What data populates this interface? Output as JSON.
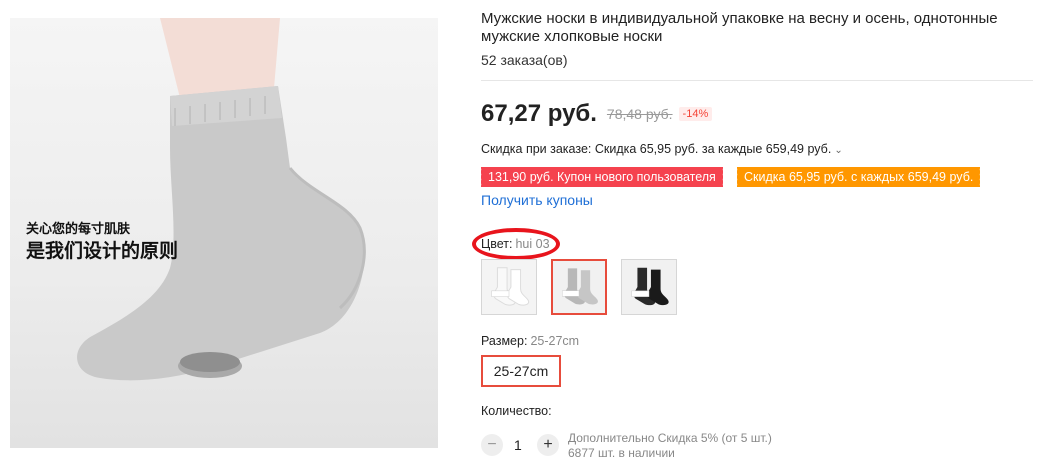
{
  "product": {
    "image_text_line1": "关心您的每寸肌肤",
    "image_text_line2": "是我们设计的原则",
    "title": "Мужские носки в индивидуальной упаковке на весну и осень, однотонные мужские хлопковые носки",
    "orders": "52 заказа(ов)"
  },
  "price": {
    "current": "67,27 руб.",
    "old": "78,48 руб.",
    "discount": "-14%",
    "order_discount": "Скидка при заказе: Скидка 65,95 руб. за каждые 659,49 руб.",
    "order_discount_icon": "chevron-down-icon"
  },
  "coupons": {
    "new_user": "131,90 руб. Купон нового пользователя",
    "store": "Скидка 65,95 руб. с каждых 659,49 руб.",
    "get_link": "Получить купоны",
    "colors": {
      "red": "#f5424e",
      "orange": "#ff9700",
      "link": "#1f6fd6"
    }
  },
  "color": {
    "label": "Цвет:",
    "value": "hui 03",
    "swatches": [
      "white-socks",
      "gray-socks",
      "black-socks"
    ],
    "selected_index": 1,
    "annotation_color": "#e8141c"
  },
  "size": {
    "label": "Размер:",
    "value": "25-27cm",
    "options": [
      "25-27cm"
    ]
  },
  "quantity": {
    "label": "Количество:",
    "minus": "−",
    "plus": "+",
    "value": "1",
    "bulk_discount": "Дополнительно Скидка 5% (от 5 шт.)",
    "stock": "6877 шт. в наличии"
  }
}
